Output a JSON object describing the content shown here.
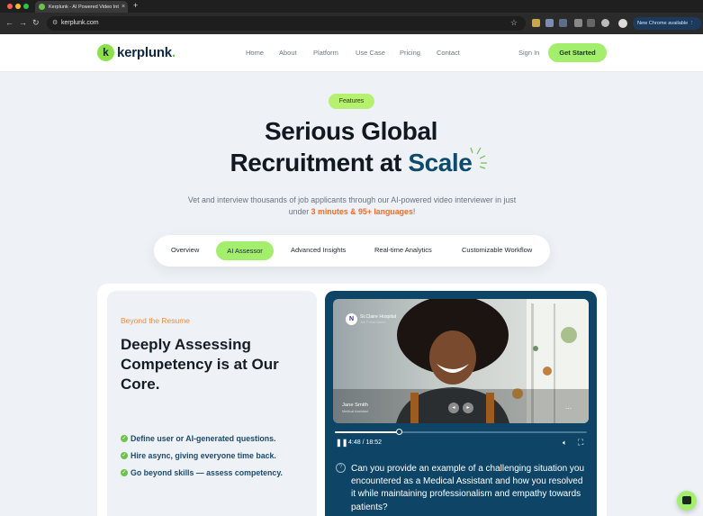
{
  "browser": {
    "tab_title": "Kerplunk - AI Powered Video Interviewer",
    "url": "kerplunk.com",
    "update_label": "New Chrome available"
  },
  "header": {
    "brand": "kerplunk",
    "brand_initial": "k",
    "nav": [
      "Home",
      "About",
      "Platform",
      "Use Case",
      "Pricing",
      "Contact"
    ],
    "signin": "Sign In",
    "cta": "Get Started"
  },
  "hero": {
    "badge": "Features",
    "title_line1": "Serious Global",
    "title_line2_prefix": "Recruitment at ",
    "title_line2_accent": "Scale",
    "lead_prefix": "Vet and interview thousands of job applicants through our AI-powered video interviewer in just under ",
    "lead_accent": "3 minutes & 95+ languages",
    "lead_suffix": "!"
  },
  "feature_tabs": {
    "items": [
      "Overview",
      "AI Assessor",
      "Advanced Insights",
      "Real-time Analytics",
      "Customizable Workflow"
    ],
    "active": "AI Assessor"
  },
  "panel": {
    "eyebrow": "Beyond the Resume",
    "heading": "Deeply Assessing Competency is at Our Core.",
    "bullets": [
      "Define user or AI-generated questions.",
      "Hire async, giving everyone time back.",
      "Go beyond skills — assess competency."
    ]
  },
  "video": {
    "org_name": "St.Claire Hospital",
    "org_sub": "Job Portal Name",
    "candidate_name": "Jane Smith",
    "candidate_role": "Medical Assistant",
    "time": "4:48 / 18:52",
    "progress": 0.255,
    "question": "Can you provide an example of a challenging situation you encountered as a Medical Assistant and how you resolved it while maintaining professionalism and empathy towards patients?"
  },
  "colors": {
    "accent_green": "#a3ee6c",
    "brand_navy": "#0e4566",
    "accent_orange": "#f06a2a"
  },
  "icons": [
    "shield-icon",
    "star-icon",
    "play-pause-icon",
    "volume-icon",
    "fullscreen-icon",
    "question-icon",
    "chat-icon"
  ]
}
